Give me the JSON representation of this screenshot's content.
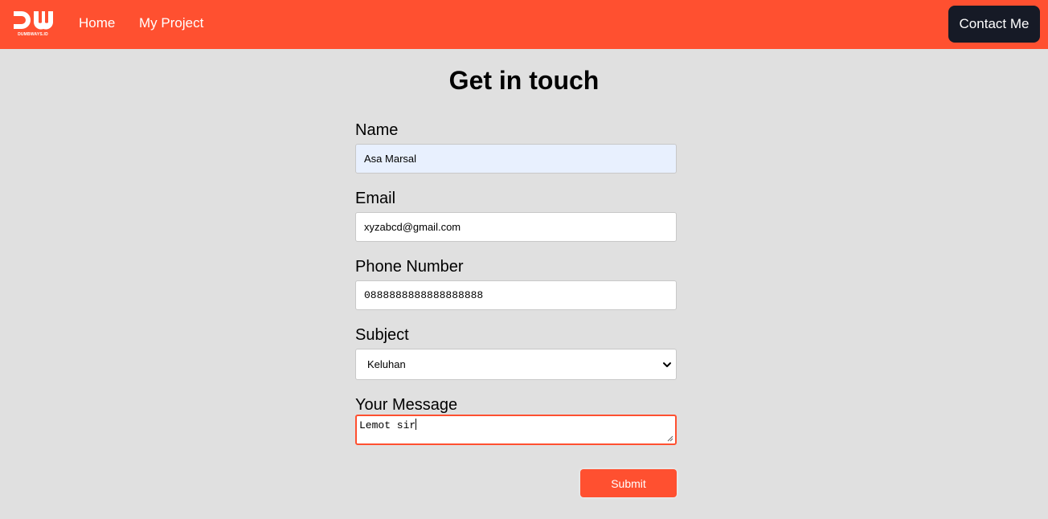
{
  "nav": {
    "logo_text": "DUMBWAYS.ID",
    "links": [
      "Home",
      "My Project"
    ],
    "contact_label": "Contact Me"
  },
  "form": {
    "title": "Get in touch",
    "name_label": "Name",
    "name_value": "Asa Marsal",
    "email_label": "Email",
    "email_value": "xyzabcd@gmail.com",
    "phone_label": "Phone Number",
    "phone_value": "0888888888888888888",
    "subject_label": "Subject",
    "subject_value": "Keluhan",
    "message_label": "Your Message",
    "message_value": "Lemot sir",
    "submit_label": "Submit"
  },
  "colors": {
    "brand": "#ff5030",
    "dark_button": "#161a26",
    "background": "#e0e0e0"
  }
}
